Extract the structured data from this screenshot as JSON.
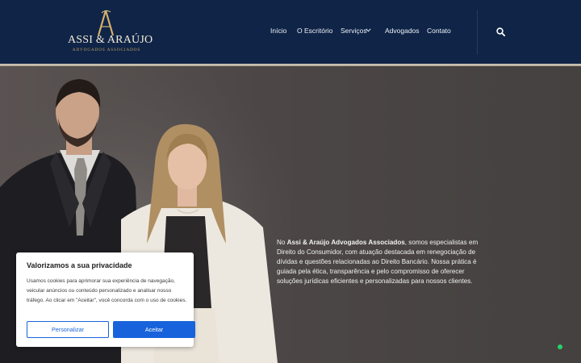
{
  "header": {
    "logo_name": "ASSI & ARAÚJO",
    "logo_subtitle": "ADVOGADOS ASSOCIADOS",
    "nav": [
      {
        "label": "Início"
      },
      {
        "label": "O Escritório"
      },
      {
        "label": "Serviços",
        "has_dropdown": true
      },
      {
        "label": "Advogados"
      },
      {
        "label": "Contato"
      }
    ],
    "search_icon": "search-icon"
  },
  "hero": {
    "intro_prefix": "No ",
    "firm_name": "Assi & Araújo Advogados Associados",
    "intro_rest": ", somos especialistas em Direito do Consumidor, com atuação destacada em renegociação de dívidas e questões relacionadas ao Direito Bancário. Nossa prática é guiada pela ética, transparência e pelo compromisso de oferecer soluções jurídicas eficientes e personalizadas para nossos clientes."
  },
  "cookie_banner": {
    "title": "Valorizamos a sua privacidade",
    "body": "Usamos cookies para aprimorar sua experiência de navegação, veicular anúncios ou conteúdo personalizado e analisar nosso tráfego. Ao clicar em \"Aceitar\", você concorda com o uso de cookies.",
    "customize_label": "Personalizar",
    "accept_label": "Aceitar"
  },
  "colors": {
    "header_bg": "#0f2447",
    "gold": "#c9a65b",
    "button_blue": "#1863dc",
    "status_green": "#25d366"
  }
}
